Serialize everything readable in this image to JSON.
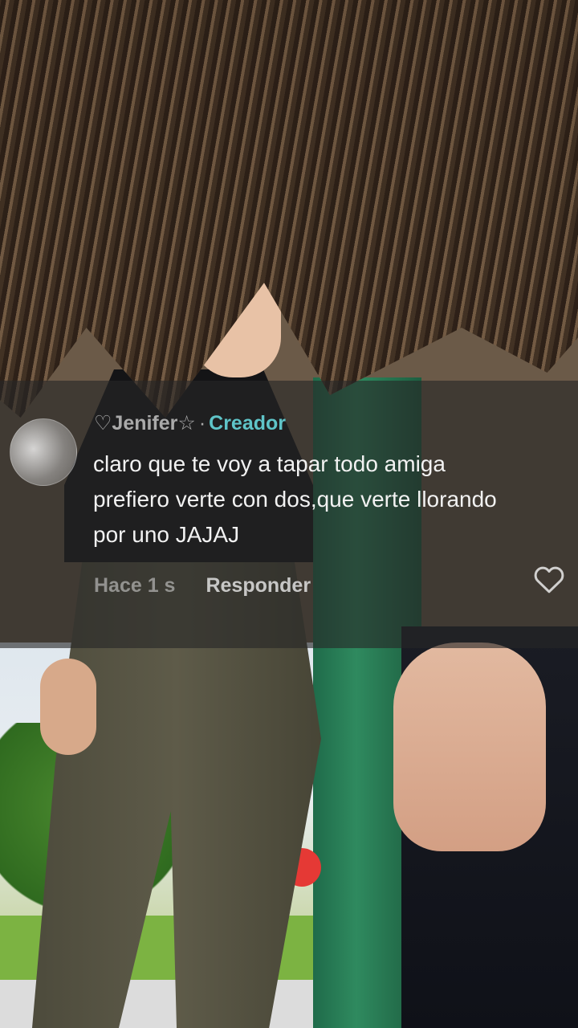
{
  "comment": {
    "author": "♡Jenifer☆",
    "separator": "·",
    "badge": "Creador",
    "text": "claro que te voy a tapar todo amiga prefiero verte con dos,que verte llorando por uno JAJAJ",
    "time": "Hace 1 s",
    "reply_label": "Responder"
  },
  "icons": {
    "avatar": "avatar",
    "like": "heart-outline-icon"
  },
  "colors": {
    "badge": "#5fc4c8",
    "panel": "rgba(38,38,38,0.62)"
  }
}
